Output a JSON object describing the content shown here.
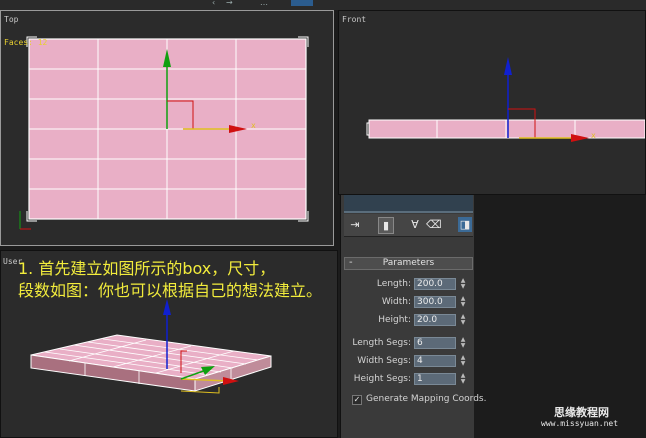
{
  "toolbar": {
    "fragments": [
      "‹",
      "→",
      "…",
      "≡",
      "•"
    ]
  },
  "viewports": {
    "top": {
      "label": "Top",
      "stats": "Faces: 12",
      "axis_x": "x"
    },
    "front": {
      "label": "Front",
      "axis_x": "x"
    },
    "user": {
      "label": "User"
    }
  },
  "annotation": {
    "line1": "1. 首先建立如图所示的box，尺寸，",
    "line2": "段数如图：你也可以根据自己的想法建立。"
  },
  "panel": {
    "rollout_title": "Parameters",
    "collapse_symbol": "-",
    "parameters": [
      {
        "label": "Length:",
        "value": "200.0"
      },
      {
        "label": "Width:",
        "value": "300.0"
      },
      {
        "label": "Height:",
        "value": "20.0"
      },
      {
        "label": "Length Segs:",
        "value": "6"
      },
      {
        "label": "Width Segs:",
        "value": "4"
      },
      {
        "label": "Height Segs:",
        "value": "1"
      }
    ],
    "generate_mapping": {
      "label": "Generate Mapping Coords.",
      "checked": true
    }
  },
  "watermark": {
    "cn": "思缘教程网",
    "en": "www.missyuan.net"
  },
  "colors": {
    "box_fill": "#e9afc6",
    "grid": "#ffffff",
    "axis_x": "#d01010",
    "axis_y": "#10a010",
    "axis_z": "#1020d0",
    "gizmo_yellow": "#e0c020",
    "annotation": "#f2ec3c"
  }
}
